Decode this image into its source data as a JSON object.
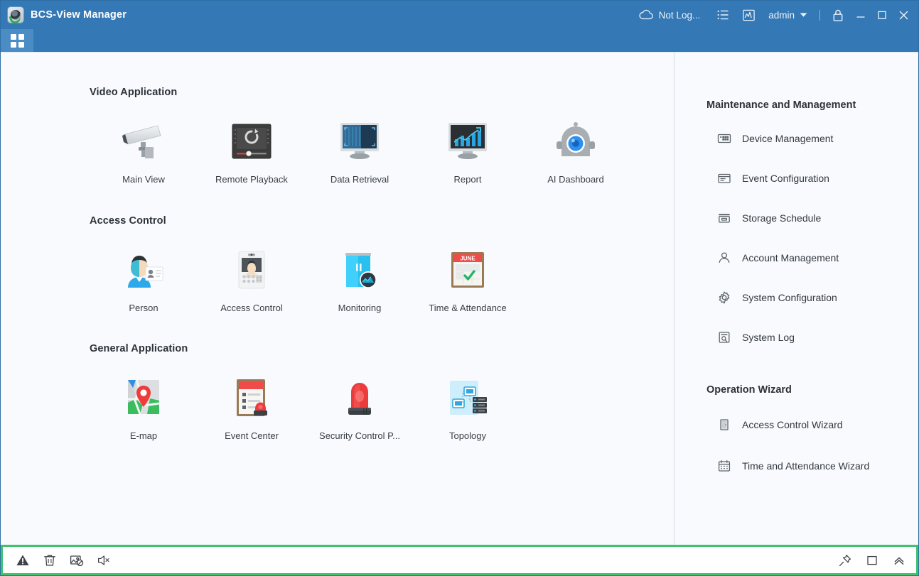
{
  "window": {
    "title": "BCS-View Manager",
    "logo_icon": "bcs-camera-logo"
  },
  "titlebar": {
    "cloud_status": "Not Log...",
    "cloud_icon": "cloud-icon",
    "list_icon": "bulleted-list-icon",
    "chart_icon": "chart-box-icon",
    "user": "admin",
    "user_dropdown_icon": "chevron-down-icon",
    "lock_icon": "lock-icon",
    "minimize_icon": "minimize-icon",
    "maximize_icon": "maximize-icon",
    "close_icon": "close-icon"
  },
  "tabstrip": {
    "home_tab_icon": "apps-grid-icon"
  },
  "sections": [
    {
      "title": "Video Application",
      "tiles": [
        {
          "label": "Main View",
          "icon": "cctv-camera-icon"
        },
        {
          "label": "Remote Playback",
          "icon": "playback-screen-icon"
        },
        {
          "label": "Data Retrieval",
          "icon": "monitor-search-icon"
        },
        {
          "label": "Report",
          "icon": "monitor-chart-icon"
        },
        {
          "label": "AI Dashboard",
          "icon": "robot-head-icon"
        }
      ]
    },
    {
      "title": "Access Control",
      "tiles": [
        {
          "label": "Person",
          "icon": "person-id-card-icon"
        },
        {
          "label": "Access Control",
          "icon": "face-terminal-icon"
        },
        {
          "label": "Monitoring",
          "icon": "door-monitoring-icon"
        },
        {
          "label": "Time & Attendance",
          "icon": "calendar-check-icon",
          "calendar_month": "JUNE"
        }
      ]
    },
    {
      "title": "General Application",
      "tiles": [
        {
          "label": "E-map",
          "icon": "map-pin-icon"
        },
        {
          "label": "Event Center",
          "icon": "clipboard-alarm-icon"
        },
        {
          "label": "Security Control P...",
          "icon": "alarm-siren-icon"
        },
        {
          "label": "Topology",
          "icon": "network-topology-icon"
        }
      ]
    }
  ],
  "right_pane": {
    "groups": [
      {
        "title": "Maintenance and Management",
        "items": [
          {
            "label": "Device Management",
            "icon": "device-icon"
          },
          {
            "label": "Event Configuration",
            "icon": "event-config-icon"
          },
          {
            "label": "Storage Schedule",
            "icon": "storage-icon"
          },
          {
            "label": "Account Management",
            "icon": "user-account-icon"
          },
          {
            "label": "System Configuration",
            "icon": "gear-icon"
          },
          {
            "label": "System Log",
            "icon": "log-search-icon"
          }
        ]
      },
      {
        "title": "Operation Wizard",
        "items": [
          {
            "label": "Access Control Wizard",
            "icon": "door-wizard-icon"
          },
          {
            "label": "Time and Attendance Wizard",
            "icon": "calendar-wizard-icon"
          }
        ]
      }
    ]
  },
  "statusbar": {
    "left_icons": [
      {
        "name": "alarm-warning-icon"
      },
      {
        "name": "trash-icon"
      },
      {
        "name": "image-off-icon"
      },
      {
        "name": "mute-speaker-icon"
      }
    ],
    "right_icons": [
      {
        "name": "pin-icon"
      },
      {
        "name": "maximize-panel-icon"
      },
      {
        "name": "collapse-up-icon"
      }
    ],
    "highlight_color": "#3ec46d"
  },
  "colors": {
    "titlebar_blue": "#3478b5",
    "tab_active_blue": "#4b8cc4",
    "background": "#f8fafd",
    "accent_green": "#3ec46d",
    "text_dark": "#2d3238"
  }
}
